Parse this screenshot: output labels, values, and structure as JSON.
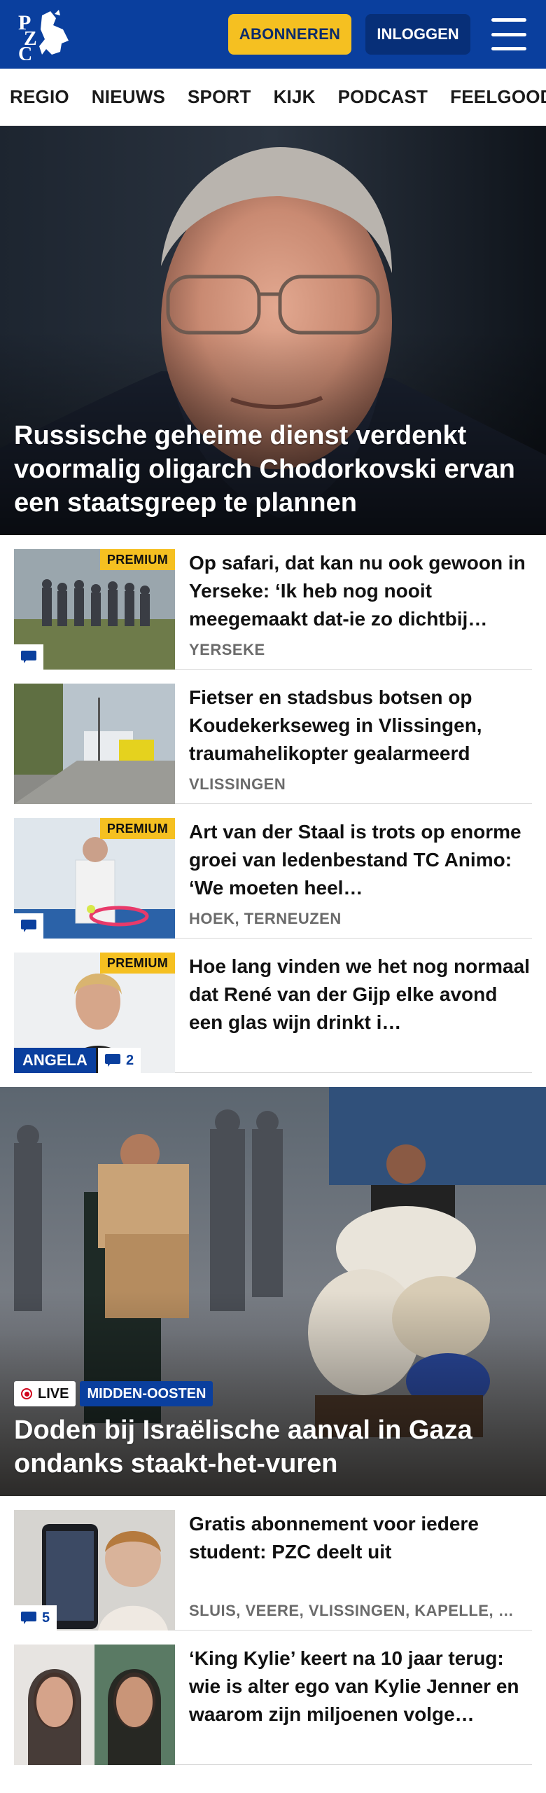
{
  "header": {
    "logo_text": "PZC",
    "subscribe_label": "ABONNEREN",
    "login_label": "INLOGGEN"
  },
  "nav": {
    "items": [
      {
        "label": "REGIO"
      },
      {
        "label": "NIEUWS"
      },
      {
        "label": "SPORT"
      },
      {
        "label": "KIJK"
      },
      {
        "label": "PODCAST"
      },
      {
        "label": "FEELGOOD"
      },
      {
        "label": "F"
      }
    ]
  },
  "hero": {
    "title": "Russische geheime dienst verdenkt voormalig oligarch Chodorkovski ervan een staatsgreep te plannen"
  },
  "articles1": [
    {
      "title": "Op safari, dat kan nu ook gewoon in Yerseke: ‘Ik heb nog nooit meegemaakt dat-ie zo dichtbij…",
      "meta": "YERSEKE",
      "premium": "PREMIUM",
      "comments": ""
    },
    {
      "title": "Fietser en stadsbus botsen op Koudekerkseweg in Vlissingen, traumahelikopter gealarmeerd",
      "meta": "VLISSINGEN"
    },
    {
      "title": "Art van der Staal is trots op enorme groei van ledenbestand TC Animo: ‘We moeten heel…",
      "meta": "HOEK, TERNEUZEN",
      "premium": "PREMIUM",
      "comments": ""
    },
    {
      "title": "Hoe lang vinden we het nog normaal dat René van der Gijp elke avond een glas wijn drinkt i…",
      "meta": "",
      "premium": "PREMIUM",
      "author": "ANGELA",
      "comments": "2"
    }
  ],
  "hero2": {
    "live_label": "LIVE",
    "section_label": "MIDDEN-OOSTEN",
    "title": "Doden bij Israëlische aanval in Gaza ondanks staakt-het-vuren"
  },
  "articles2": [
    {
      "title": "Gratis abonnement voor iedere student: PZC deelt uit",
      "meta": "SLUIS, VEERE, VLISSINGEN, KAPELLE, …",
      "comments": "5"
    },
    {
      "title": "‘King Kylie’ keert na 10 jaar terug: wie is alter ego van Kylie Jenner en waarom zijn miljoenen volge…",
      "meta": ""
    }
  ],
  "colors": {
    "brand_blue": "#0a3f9e",
    "accent_yellow": "#f5c021"
  }
}
